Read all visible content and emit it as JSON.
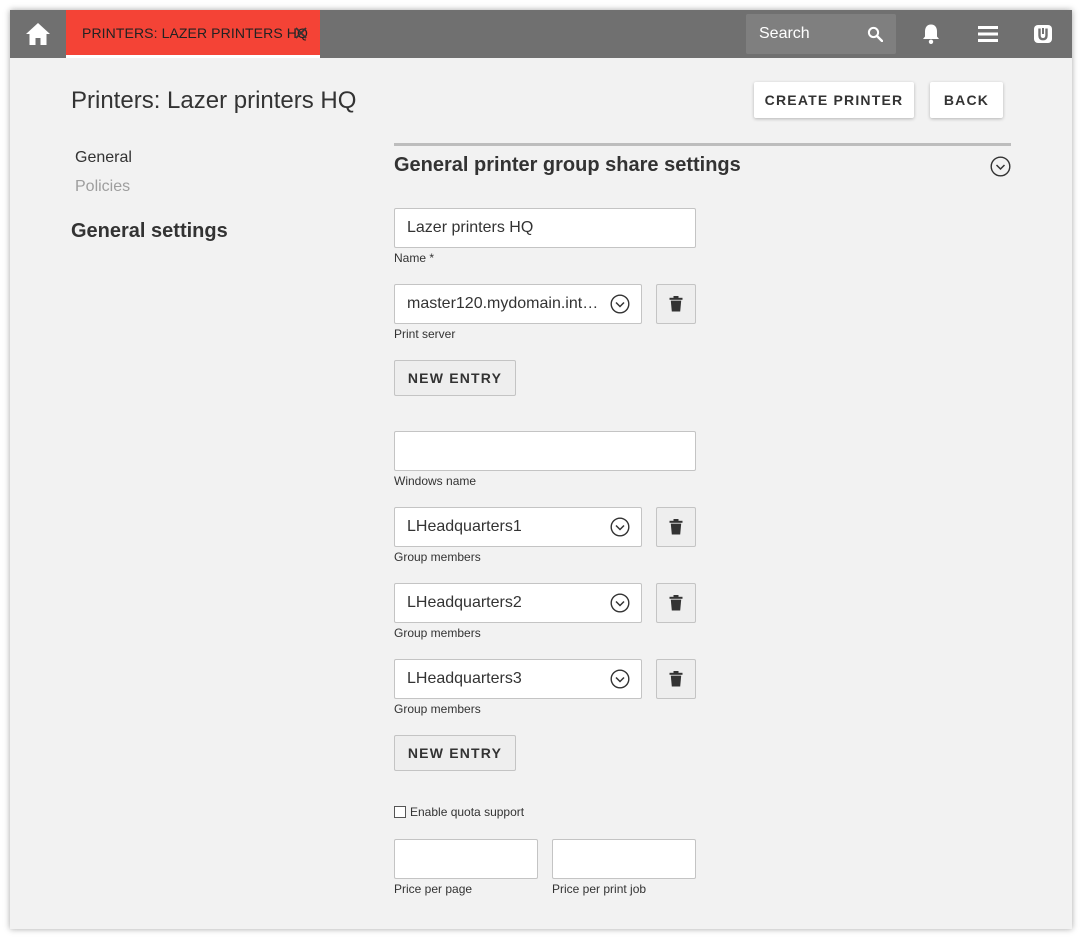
{
  "topbar": {
    "tab_label": "PRINTERS: LAZER PRINTERS HQ",
    "search_placeholder": "Search",
    "accent_color": "#f44336",
    "bar_color": "#707070"
  },
  "page": {
    "title": "Printers: Lazer printers HQ",
    "create_button": "CREATE PRINTER",
    "back_button": "BACK"
  },
  "sidebar": {
    "items": [
      {
        "label": "General",
        "active": true
      },
      {
        "label": "Policies",
        "active": false
      }
    ],
    "heading": "General settings"
  },
  "section": {
    "title": "General printer group share settings"
  },
  "form": {
    "name": {
      "value": "Lazer printers HQ",
      "label": "Name *"
    },
    "print_servers": [
      {
        "value": "master120.mydomain.int…",
        "label": "Print server"
      }
    ],
    "new_entry_label": "NEW ENTRY",
    "windows_name": {
      "value": "",
      "label": "Windows name"
    },
    "group_members": [
      {
        "value": "LHeadquarters1",
        "label": "Group members"
      },
      {
        "value": "LHeadquarters2",
        "label": "Group members"
      },
      {
        "value": "LHeadquarters3",
        "label": "Group members"
      }
    ],
    "quota": {
      "label": "Enable quota support",
      "checked": false
    },
    "price_per_page": {
      "value": "",
      "label": "Price per page"
    },
    "price_per_job": {
      "value": "",
      "label": "Price per print job"
    }
  }
}
